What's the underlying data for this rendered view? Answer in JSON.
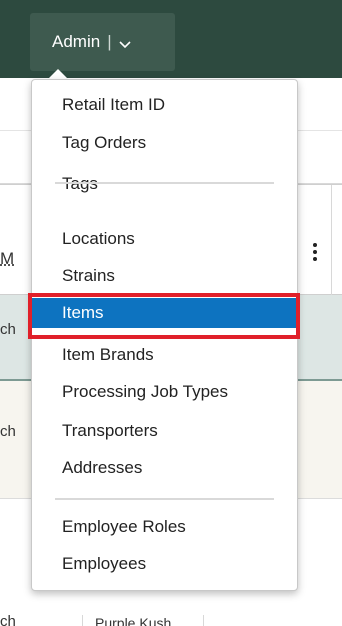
{
  "nav": {
    "admin_label": "Admin",
    "admin_separator": "|",
    "chevron_icon": "chevron-down-icon"
  },
  "table": {
    "header_edge_text": "M",
    "row_edge_text_1": "ch",
    "row_edge_text_2": "ch",
    "row_edge_text_3": "ch",
    "strain_cell": "Purple Kush"
  },
  "menu": {
    "group1": [
      "Retail Item ID",
      "Tag Orders",
      "Tags"
    ],
    "group2": [
      "Locations",
      "Strains",
      "Items",
      "Item Brands",
      "Processing Job Types",
      "Transporters",
      "Addresses"
    ],
    "group3": [
      "Employee Roles",
      "Employees"
    ],
    "active_item": "Items"
  },
  "colors": {
    "nav_bg": "#2d4a3f",
    "active_bg": "#0d73c0",
    "highlight": "#e0202a"
  }
}
